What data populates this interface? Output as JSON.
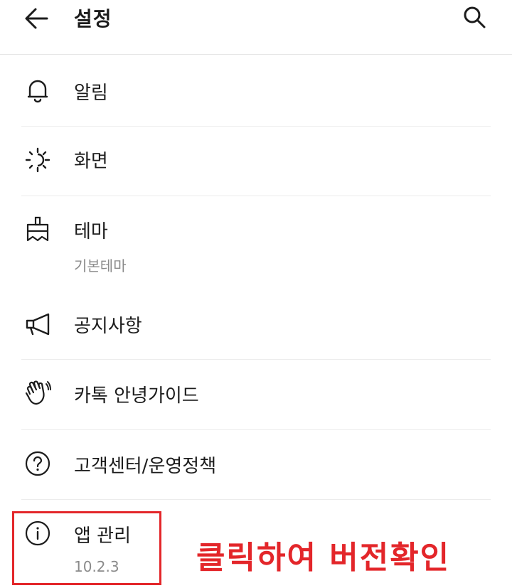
{
  "header": {
    "title": "설정",
    "back_icon": "arrow-left-icon",
    "search_icon": "search-icon"
  },
  "items": [
    {
      "label": "알림",
      "icon": "bell-icon"
    },
    {
      "label": "화면",
      "icon": "brightness-icon"
    },
    {
      "label": "테마",
      "sub": "기본테마",
      "icon": "paint-brush-icon"
    },
    {
      "label": "공지사항",
      "icon": "megaphone-icon"
    },
    {
      "label": "카톡 안녕가이드",
      "icon": "waving-hand-icon"
    },
    {
      "label": "고객센터/운영정책",
      "icon": "help-circle-icon"
    },
    {
      "label": "앱 관리",
      "sub": "10.2.3",
      "icon": "info-circle-icon"
    }
  ],
  "annotation": {
    "text": "클릭하여 버전확인",
    "color": "#e3262a"
  },
  "colors": {
    "text": "#1c1c1c",
    "subtext": "#8a8a8a",
    "divider": "#ececec",
    "accent": "#e3262a"
  }
}
